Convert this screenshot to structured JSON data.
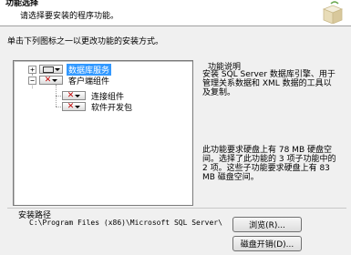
{
  "header": {
    "title": "功能选择",
    "subtitle": "请选择要安装的程序功能。"
  },
  "instruction": "单击下列图标之一以更改功能的安装方式。",
  "tree": [
    {
      "label": "数据库服务",
      "expander": "+",
      "selected": true
    },
    {
      "label": "客户端组件",
      "expander": "−",
      "selected": false
    },
    {
      "label": "连接组件",
      "expander": "",
      "selected": false
    },
    {
      "label": "软件开发包",
      "expander": "",
      "selected": false
    }
  ],
  "description": {
    "title": "功能说明",
    "text": "安装 SQL Server 数据库引擎、用于管理关系数据和 XML 数据的工具以及复制。",
    "space": "此功能要求硬盘上有 78 MB 硬盘空间。选择了此功能的 3 项子功能中的 2 项。这些子功能要求硬盘上有 83 MB 磁盘空间。"
  },
  "install_path": {
    "label": "安装路径",
    "value": "C:\\Program Files (x86)\\Microsoft SQL Server\\"
  },
  "buttons": {
    "browse": "浏览(R)...",
    "disk_cost": "磁盘开销(D)..."
  }
}
